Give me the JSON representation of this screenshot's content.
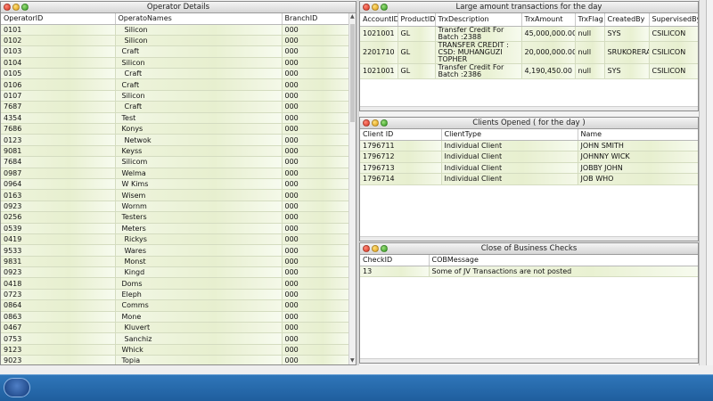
{
  "operator_panel": {
    "title": "Operator Details",
    "columns": [
      "OperatorID",
      "OperatoNames",
      "BranchID"
    ],
    "rows": [
      [
        "0101",
        "Silicon",
        "000"
      ],
      [
        "0102",
        "Silicon",
        "000"
      ],
      [
        "0103",
        "Craft",
        "000"
      ],
      [
        "0104",
        "Silicon",
        "000"
      ],
      [
        "0105",
        "Craft",
        "000"
      ],
      [
        "0106",
        "Craft",
        "000"
      ],
      [
        "0107",
        "Silicon",
        "000"
      ],
      [
        "7687",
        "Craft",
        "000"
      ],
      [
        "4354",
        "Test",
        "000"
      ],
      [
        "7686",
        "Konys",
        "000"
      ],
      [
        "0123",
        "Netwok",
        "000"
      ],
      [
        "9081",
        "Keyss",
        "000"
      ],
      [
        "7684",
        "Silicom",
        "000"
      ],
      [
        "0987",
        "Welma",
        "000"
      ],
      [
        "0964",
        "W Kims",
        "000"
      ],
      [
        "0163",
        "Wisem",
        "000"
      ],
      [
        "0923",
        "Wornm",
        "000"
      ],
      [
        "0256",
        "Testers",
        "000"
      ],
      [
        "0539",
        "Meters",
        "000"
      ],
      [
        "0419",
        "Rickys",
        "000"
      ],
      [
        "9533",
        "Wares",
        "000"
      ],
      [
        "9831",
        "Monst",
        "000"
      ],
      [
        "0923",
        "Kingd",
        "000"
      ],
      [
        "0418",
        "Doms",
        "000"
      ],
      [
        "0723",
        "Eleph",
        "000"
      ],
      [
        "0864",
        "Comms",
        "000"
      ],
      [
        "0863",
        "Mone",
        "000"
      ],
      [
        "0467",
        "Kluvert",
        "000"
      ],
      [
        "0753",
        "Sanchiz",
        "000"
      ],
      [
        "9123",
        "Whick",
        "000"
      ],
      [
        "9023",
        "Topia",
        "000"
      ]
    ]
  },
  "large_txn_panel": {
    "title": "Large amount transactions for the day",
    "columns": [
      "AccountID",
      "ProductID",
      "TrxDescription",
      "TrxAmount",
      "TrxFlag",
      "CreatedBy",
      "SupervisedBy"
    ],
    "rows": [
      [
        "1021001",
        "GL",
        "Transfer Credit For Batch :2388",
        "45,000,000.00",
        "null",
        "SYS",
        "CSILICON"
      ],
      [
        "2201710",
        "GL",
        "TRANSFER CREDIT : CSD: MUHANGUZI TOPHER",
        "20,000,000.00",
        "null",
        "SRUKORERA",
        "CSILICON"
      ],
      [
        "1021001",
        "GL",
        "Transfer Credit For Batch :2386",
        "4,190,450.00",
        "null",
        "SYS",
        "CSILICON"
      ]
    ]
  },
  "clients_panel": {
    "title": "Clients Opened ( for the day )",
    "columns": [
      "Client ID",
      "ClientType",
      "Name"
    ],
    "rows": [
      [
        "1796711",
        "Individual Client",
        "JOHN SMITH"
      ],
      [
        "1796712",
        "Individual Client",
        "JOHNNY WICK"
      ],
      [
        "1796713",
        "Individual Client",
        "JOBBY JOHN"
      ],
      [
        "1796714",
        "Individual Client",
        "JOB WHO"
      ]
    ]
  },
  "cob_panel": {
    "title": "Close of Business Checks",
    "columns": [
      "CheckID",
      "COBMessage"
    ],
    "rows": [
      [
        "13",
        "Some of JV Transactions are not posted"
      ]
    ]
  },
  "taskbar": {
    "start_label": "start"
  },
  "colors": {
    "row_green": "#e7efcf",
    "taskbar_blue": "#2f76b9",
    "close_red": "#d8321e",
    "minimize_yellow": "#e09a12",
    "maximize_green": "#2f9a1d"
  }
}
